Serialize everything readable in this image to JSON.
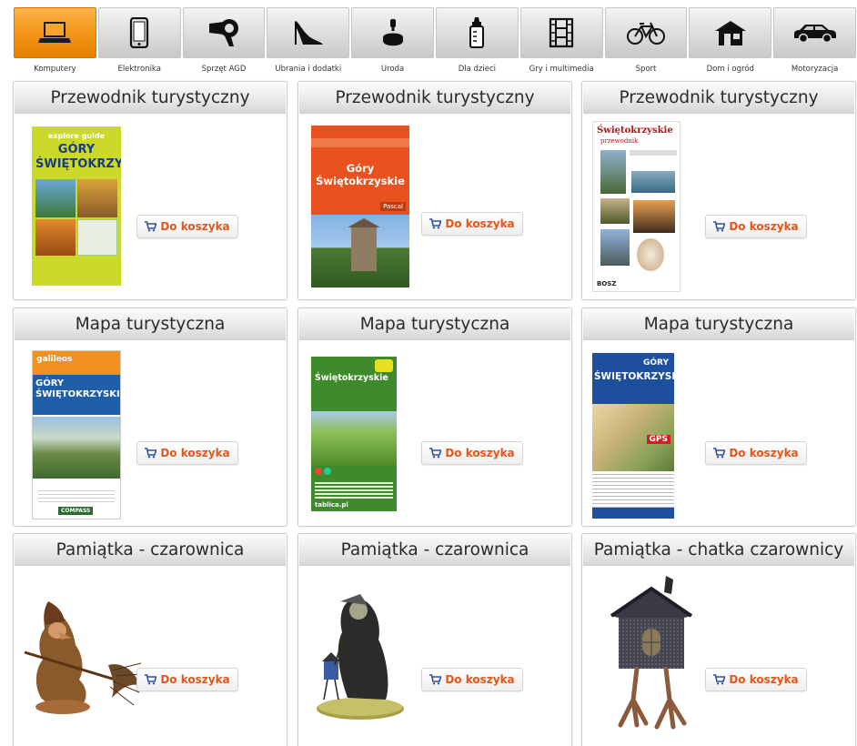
{
  "categories": [
    {
      "label": "Komputery",
      "icon": "laptop-icon",
      "active": true
    },
    {
      "label": "Elektronika",
      "icon": "phone-icon",
      "active": false
    },
    {
      "label": "Sprzęt AGD",
      "icon": "hairdryer-icon",
      "active": false
    },
    {
      "label": "Ubrania i dodatki",
      "icon": "high-heel-icon",
      "active": false
    },
    {
      "label": "Uroda",
      "icon": "perfume-icon",
      "active": false
    },
    {
      "label": "Dla dzieci",
      "icon": "baby-bottle-icon",
      "active": false
    },
    {
      "label": "Gry i multimedia",
      "icon": "film-strip-icon",
      "active": false
    },
    {
      "label": "Sport",
      "icon": "bicycle-icon",
      "active": false
    },
    {
      "label": "Dom i ogród",
      "icon": "house-icon",
      "active": false
    },
    {
      "label": "Motoryzacja",
      "icon": "car-icon",
      "active": false
    }
  ],
  "colors": {
    "accent": "#f39617",
    "cart_text": "#e3561a"
  },
  "products": [
    {
      "title": "Przewodnik turystyczny",
      "cover": {
        "top": "explore guide",
        "main": "GÓRY ŚWIĘTOKRZYSKIE"
      }
    },
    {
      "title": "Przewodnik turystyczny",
      "cover": {
        "top": "",
        "main": "Góry Świętokrzyskie",
        "tag": "Pascal"
      }
    },
    {
      "title": "Przewodnik turystyczny",
      "cover": {
        "top": "Świętokrzyskie",
        "main": "przewodnik",
        "tag": "BOSZ"
      }
    },
    {
      "title": "Mapa turystyczna",
      "cover": {
        "top": "galileos",
        "main": "GÓRY ŚWIĘTOKRZYSKIE",
        "tag": "COMPASS"
      }
    },
    {
      "title": "Mapa turystyczna",
      "cover": {
        "top": "Świętokrzyskie",
        "main": "",
        "tag": "tablica.pl"
      }
    },
    {
      "title": "Mapa turystyczna",
      "cover": {
        "top": "GÓRY",
        "main": "ŚWIĘTOKRZYSKIE",
        "tag": "GPS"
      }
    },
    {
      "title": "Pamiątka - czarownica"
    },
    {
      "title": "Pamiątka - czarownica"
    },
    {
      "title": "Pamiątka - chatka czarownicy"
    }
  ],
  "cart_label": "Do koszyka"
}
